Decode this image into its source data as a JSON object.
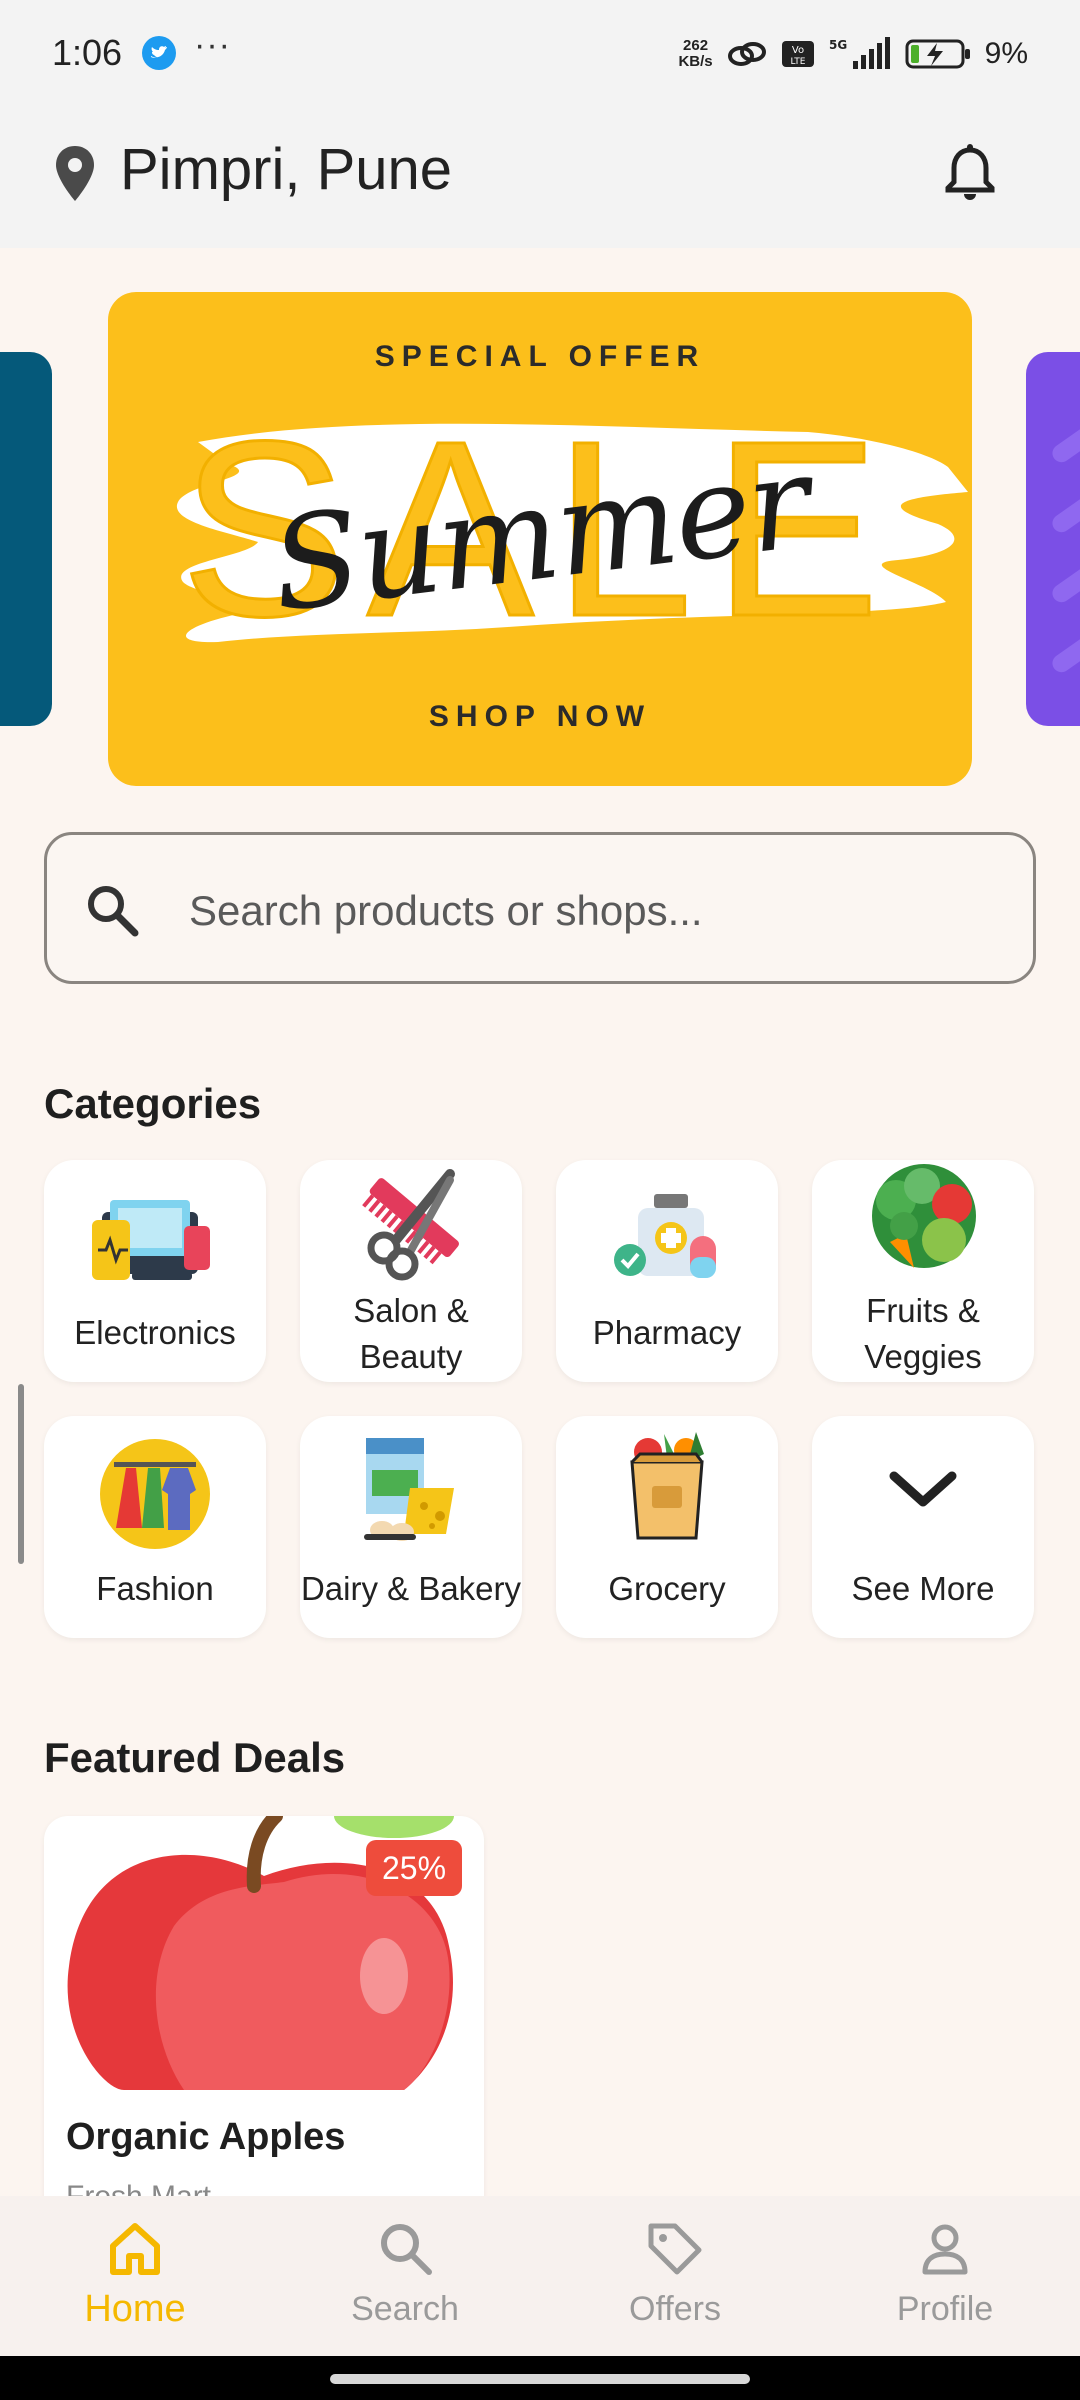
{
  "status_bar": {
    "time": "1:06",
    "more": "···",
    "speed_value": "262",
    "speed_unit": "KB/s",
    "battery_pct": "9%"
  },
  "header": {
    "location": "Pimpri, Pune"
  },
  "banner": {
    "top_text": "SPECIAL OFFER",
    "big_text": "SALE",
    "script_text": "Summer",
    "bottom_text": "SHOP NOW"
  },
  "search": {
    "placeholder": "Search products or shops..."
  },
  "categories": {
    "title": "Categories",
    "items": [
      {
        "label": "Electronics",
        "icon": "electronics-icon"
      },
      {
        "label": "Salon & Beauty",
        "icon": "salon-beauty-icon"
      },
      {
        "label": "Pharmacy",
        "icon": "pharmacy-icon"
      },
      {
        "label": "Fruits & Veggies",
        "icon": "fruits-veggies-icon"
      },
      {
        "label": "Fashion",
        "icon": "fashion-icon"
      },
      {
        "label": "Dairy & Bakery",
        "icon": "dairy-bakery-icon"
      },
      {
        "label": "Grocery",
        "icon": "grocery-icon"
      },
      {
        "label": "See More",
        "icon": "chevron-down-icon"
      }
    ]
  },
  "featured": {
    "title": "Featured Deals",
    "deals": [
      {
        "name": "Organic Apples",
        "discount": "25%",
        "shop": "Fresh Mart"
      }
    ]
  },
  "bottom_nav": {
    "items": [
      {
        "label": "Home",
        "icon": "home-icon",
        "active": true
      },
      {
        "label": "Search",
        "icon": "search-icon",
        "active": false
      },
      {
        "label": "Offers",
        "icon": "tag-icon",
        "active": false
      },
      {
        "label": "Profile",
        "icon": "profile-icon",
        "active": false
      }
    ]
  },
  "colors": {
    "accent": "#f5b800",
    "banner_bg": "#fcbf1b",
    "badge": "#ee4c3c",
    "page_bg": "#fcf5f0"
  }
}
